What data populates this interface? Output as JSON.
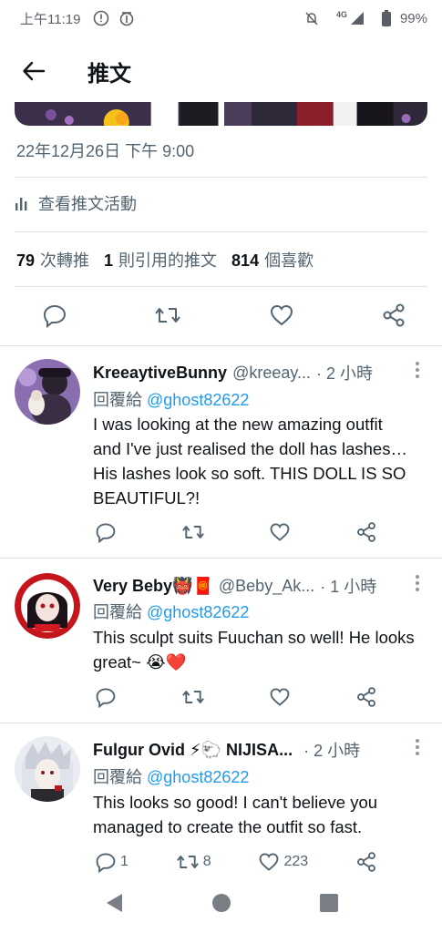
{
  "status_bar": {
    "time": "上午11:19",
    "network": "4G",
    "battery": "99%"
  },
  "app_bar": {
    "title": "推文"
  },
  "tweet": {
    "timestamp": "22年12月26日 下午 9:00",
    "activity_label": "查看推文活動",
    "stats": {
      "retweets_count": "79",
      "retweets_label": "次轉推",
      "quotes_count": "1",
      "quotes_label": "則引用的推文",
      "likes_count": "814",
      "likes_label": "個喜歡"
    }
  },
  "replies": [
    {
      "name": "KreeaytiveBunny",
      "handle": "@kreeay...",
      "time": "· 2 小時",
      "replying_prefix": "回覆給",
      "replying_to": "@ghost82622",
      "text": "I was looking at the new amazing outfit and I've just realised the doll has lashes… His lashes look so soft. THIS DOLL IS SO BEAUTIFUL?!",
      "reply_count": "",
      "retweet_count": "",
      "like_count": ""
    },
    {
      "name": "Very Beby👹🧧",
      "handle": "@Beby_Ak...",
      "time": "· 1 小時",
      "replying_prefix": "回覆給",
      "replying_to": "@ghost82622",
      "text": "This sculpt suits Fuuchan so well! He looks great~ 😭❤️",
      "reply_count": "",
      "retweet_count": "",
      "like_count": ""
    },
    {
      "name": "Fulgur Ovid ⚡🐑 NIJISA...",
      "handle": "",
      "time": "· 2 小時",
      "replying_prefix": "回覆給",
      "replying_to": "@ghost82622",
      "text": "This looks so good! I can't believe you managed to create the outfit so fast.",
      "reply_count": "1",
      "retweet_count": "8",
      "like_count": "223"
    }
  ],
  "colors": {
    "accent": "#1d9bf0",
    "secondary_text": "#536471",
    "divider": "#dfe3e6"
  },
  "icons": [
    "back-arrow-icon",
    "reply-icon",
    "retweet-icon",
    "like-icon",
    "share-icon",
    "more-icon",
    "bar-chart-icon"
  ]
}
